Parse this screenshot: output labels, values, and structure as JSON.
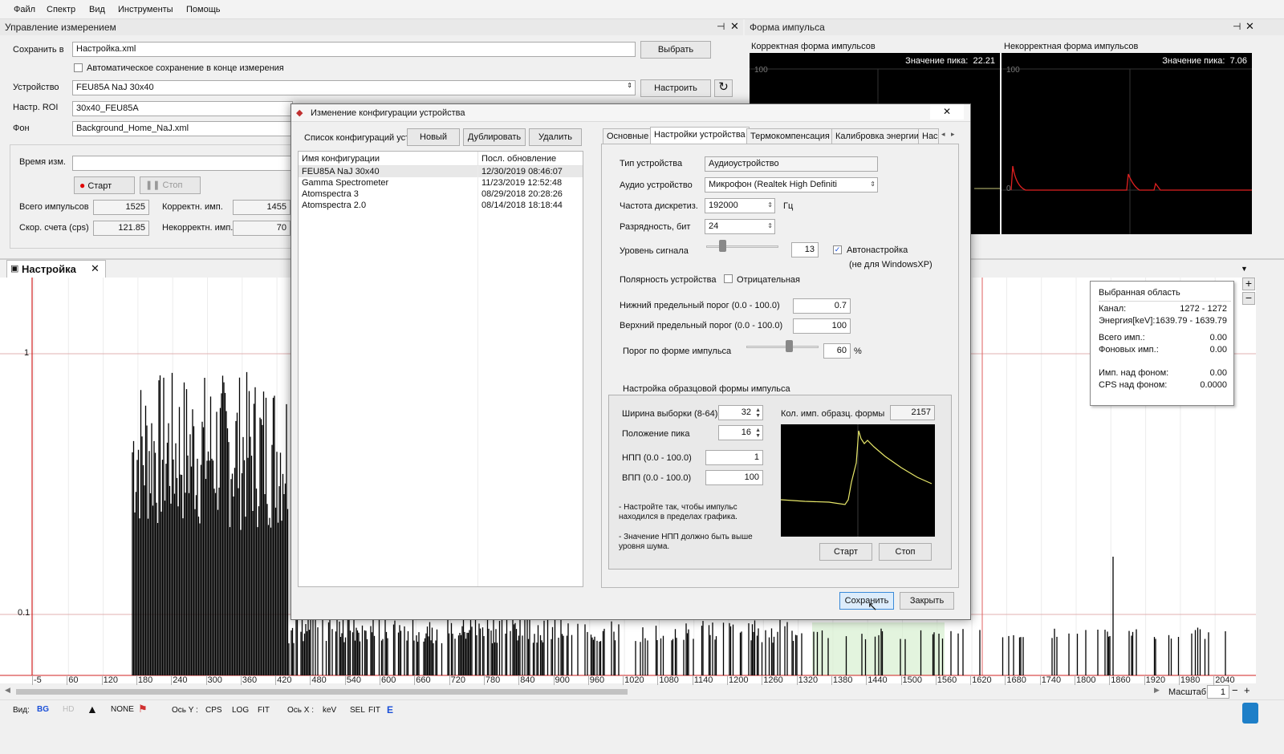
{
  "menu": [
    "Файл",
    "Спектр",
    "Вид",
    "Инструменты",
    "Помощь"
  ],
  "measure": {
    "title": "Управление измерением",
    "save_label": "Сохранить в",
    "save_value": "Настройка.xml",
    "choose_button": "Выбрать",
    "autosave_label": "Автоматическое сохранение в конце измерения",
    "device_label": "Устройство",
    "device_value": "FEU85A NaJ 30x40",
    "configure_button": "Настроить",
    "roi_label": "Настр. ROI",
    "roi_value": "30x40_FEU85A",
    "bg_label": "Фон",
    "bg_value": "Background_Home_NaJ.xml",
    "time_label": "Время изм.",
    "start_button": "Старт",
    "stop_button": "Стоп",
    "total_label": "Всего импульсов",
    "total_value": "1525",
    "correct_label": "Корректн. имп.",
    "correct_value": "1455",
    "rate_label": "Скор. счета (cps)",
    "rate_value": "121.85",
    "incorrect_label": "Некорректн. имп.",
    "incorrect_value": "70"
  },
  "pulse": {
    "title": "Форма импульса",
    "correct_title": "Корректная форма импульсов",
    "correct_peak_label": "Значение пика:",
    "correct_peak": "22.21",
    "correct_axis": "100",
    "incorrect_title": "Некорректная форма импульсов",
    "incorrect_peak_label": "Значение пика:",
    "incorrect_peak": "7.06",
    "incorrect_axis": "100",
    "incorrect_zero": "0"
  },
  "spectrum": {
    "tab": "Настройка",
    "y_labels": [
      "1",
      "0.1"
    ],
    "x_ticks": [
      "-5",
      "60",
      "120",
      "180",
      "240",
      "300",
      "360",
      "420",
      "480",
      "540",
      "600",
      "660",
      "720",
      "780",
      "840",
      "900",
      "960",
      "1020",
      "1080",
      "1140",
      "1200",
      "1260",
      "1320",
      "1380",
      "1440",
      "1500",
      "1560",
      "1620",
      "1680",
      "1740",
      "1800",
      "1860",
      "1920",
      "1980",
      "2040"
    ],
    "scale_label": "Масштаб",
    "scale_value": "1"
  },
  "roi_box": {
    "title": "Выбранная область",
    "rows": [
      {
        "label": "Канал:",
        "value": "1272 - 1272"
      },
      {
        "label": "Энергия[keV]:",
        "value": "1639.79 - 1639.79"
      },
      {
        "label": "Всего имп.:",
        "value": "0.00"
      },
      {
        "label": "Фоновых имп.:",
        "value": "0.00"
      },
      {
        "label": "Имп. над фоном:",
        "value": "0.00"
      },
      {
        "label": "CPS над фоном:",
        "value": "0.0000"
      }
    ]
  },
  "toolbar": {
    "view": "Вид:",
    "bg": "BG",
    "hd": "HD",
    "none": "NONE",
    "yaxis": "Ось Y :",
    "cps": "CPS",
    "log": "LOG",
    "fit": "FIT",
    "xaxis": "Ось X :",
    "kev": "keV",
    "sel": "SEL",
    "fit2": "FIT",
    "e": "E"
  },
  "dialog": {
    "title": "Изменение конфигурации устройства",
    "list_label": "Список конфигураций устр.",
    "new_button": "Новый",
    "dup_button": "Дублировать",
    "del_button": "Удалить",
    "col_name": "Имя конфигурации",
    "col_updated": "Посл. обновление",
    "configs": [
      {
        "name": "FEU85A NaJ 30x40",
        "updated": "12/30/2019 08:46:07"
      },
      {
        "name": "Gamma Spectrometer",
        "updated": "11/23/2019 12:52:48"
      },
      {
        "name": "Atomspectra 3",
        "updated": "08/29/2018 20:28:26"
      },
      {
        "name": "Atomspectra 2.0",
        "updated": "08/14/2018 18:18:44"
      }
    ],
    "tabs": [
      "Основные",
      "Настройки устройства",
      "Термокомпенсация",
      "Калибровка энергии",
      "Нас"
    ],
    "device_type_label": "Тип устройства",
    "device_type": "Аудиоустройство",
    "audio_label": "Аудио устройство",
    "audio": "Микрофон (Realtek High Definiti",
    "rate_label": "Частота дискретиз.",
    "rate": "192000",
    "rate_unit": "Гц",
    "bits_label": "Разрядность, бит",
    "bits": "24",
    "level_label": "Уровень сигнала",
    "level": "13",
    "level_pct": 0.2,
    "auto_label": "Автонастройка",
    "auto_note": "(не для WindowsXP)",
    "polarity_label": "Полярность устройства",
    "negative_label": "Отрицательная",
    "low_label": "Нижний предельный порог (0.0 - 100.0)",
    "low": "0.7",
    "high_label": "Верхний предельный порог (0.0 - 100.0)",
    "high": "100",
    "shape_label": "Порог по форме импульса",
    "shape": "60",
    "shape_unit": "%",
    "shape_pct": 0.6,
    "group_title": "Настройка образцовой формы импульса",
    "width_label": "Ширина выборки (8-64)",
    "width": "32",
    "peakpos_label": "Положение пика",
    "peakpos": "16",
    "count_label": "Кол. имп. образц. формы",
    "count": "2157",
    "npp_label": "НПП (0.0 - 100.0)",
    "npp": "1",
    "vpp_label": "ВПП (0.0 - 100.0)",
    "vpp": "100",
    "hint1": "- Настройте так, чтобы импульс находился в пределах графика.",
    "hint2": "- Значение НПП должно быть выше уровня шума.",
    "start_button": "Старт",
    "stop_button": "Стоп",
    "save_button": "Сохранить",
    "close_button": "Закрыть",
    "pulse_color": "#e8e86a"
  }
}
